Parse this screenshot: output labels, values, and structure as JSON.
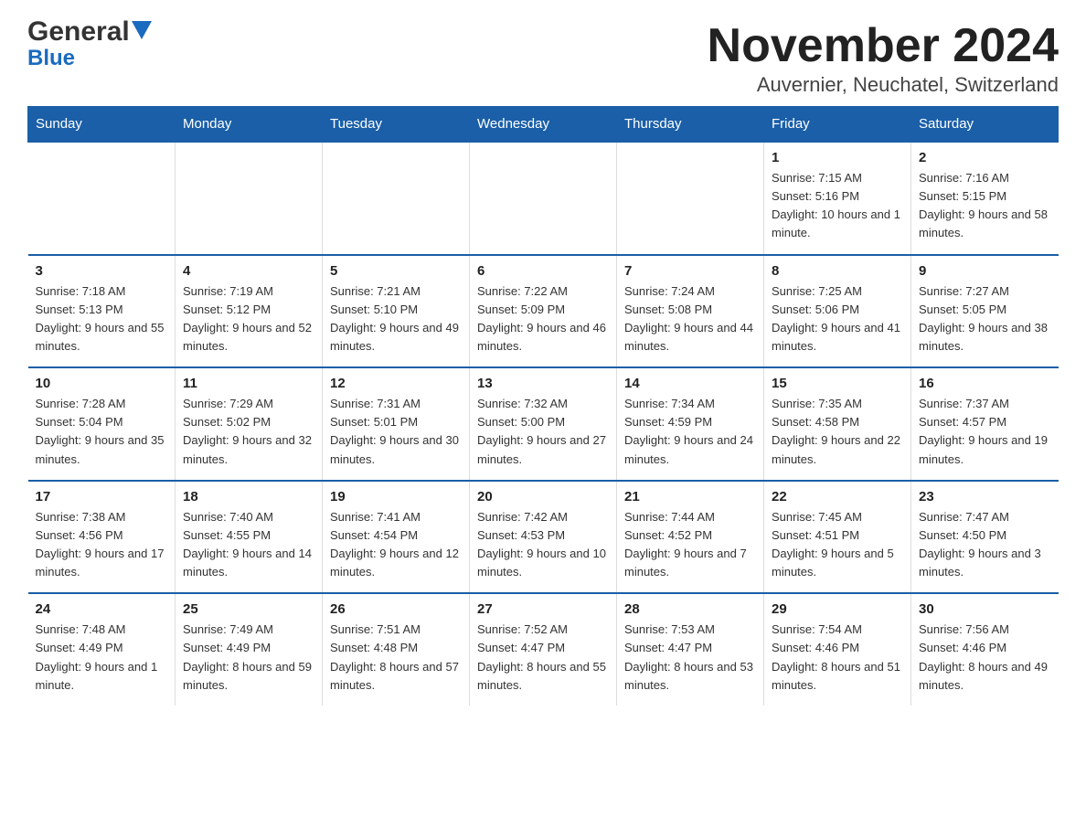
{
  "header": {
    "logo_line1": "General",
    "logo_line2": "Blue",
    "month_title": "November 2024",
    "location": "Auvernier, Neuchatel, Switzerland"
  },
  "weekdays": [
    "Sunday",
    "Monday",
    "Tuesday",
    "Wednesday",
    "Thursday",
    "Friday",
    "Saturday"
  ],
  "weeks": [
    [
      {
        "day": "",
        "info": ""
      },
      {
        "day": "",
        "info": ""
      },
      {
        "day": "",
        "info": ""
      },
      {
        "day": "",
        "info": ""
      },
      {
        "day": "",
        "info": ""
      },
      {
        "day": "1",
        "info": "Sunrise: 7:15 AM\nSunset: 5:16 PM\nDaylight: 10 hours and 1 minute."
      },
      {
        "day": "2",
        "info": "Sunrise: 7:16 AM\nSunset: 5:15 PM\nDaylight: 9 hours and 58 minutes."
      }
    ],
    [
      {
        "day": "3",
        "info": "Sunrise: 7:18 AM\nSunset: 5:13 PM\nDaylight: 9 hours and 55 minutes."
      },
      {
        "day": "4",
        "info": "Sunrise: 7:19 AM\nSunset: 5:12 PM\nDaylight: 9 hours and 52 minutes."
      },
      {
        "day": "5",
        "info": "Sunrise: 7:21 AM\nSunset: 5:10 PM\nDaylight: 9 hours and 49 minutes."
      },
      {
        "day": "6",
        "info": "Sunrise: 7:22 AM\nSunset: 5:09 PM\nDaylight: 9 hours and 46 minutes."
      },
      {
        "day": "7",
        "info": "Sunrise: 7:24 AM\nSunset: 5:08 PM\nDaylight: 9 hours and 44 minutes."
      },
      {
        "day": "8",
        "info": "Sunrise: 7:25 AM\nSunset: 5:06 PM\nDaylight: 9 hours and 41 minutes."
      },
      {
        "day": "9",
        "info": "Sunrise: 7:27 AM\nSunset: 5:05 PM\nDaylight: 9 hours and 38 minutes."
      }
    ],
    [
      {
        "day": "10",
        "info": "Sunrise: 7:28 AM\nSunset: 5:04 PM\nDaylight: 9 hours and 35 minutes."
      },
      {
        "day": "11",
        "info": "Sunrise: 7:29 AM\nSunset: 5:02 PM\nDaylight: 9 hours and 32 minutes."
      },
      {
        "day": "12",
        "info": "Sunrise: 7:31 AM\nSunset: 5:01 PM\nDaylight: 9 hours and 30 minutes."
      },
      {
        "day": "13",
        "info": "Sunrise: 7:32 AM\nSunset: 5:00 PM\nDaylight: 9 hours and 27 minutes."
      },
      {
        "day": "14",
        "info": "Sunrise: 7:34 AM\nSunset: 4:59 PM\nDaylight: 9 hours and 24 minutes."
      },
      {
        "day": "15",
        "info": "Sunrise: 7:35 AM\nSunset: 4:58 PM\nDaylight: 9 hours and 22 minutes."
      },
      {
        "day": "16",
        "info": "Sunrise: 7:37 AM\nSunset: 4:57 PM\nDaylight: 9 hours and 19 minutes."
      }
    ],
    [
      {
        "day": "17",
        "info": "Sunrise: 7:38 AM\nSunset: 4:56 PM\nDaylight: 9 hours and 17 minutes."
      },
      {
        "day": "18",
        "info": "Sunrise: 7:40 AM\nSunset: 4:55 PM\nDaylight: 9 hours and 14 minutes."
      },
      {
        "day": "19",
        "info": "Sunrise: 7:41 AM\nSunset: 4:54 PM\nDaylight: 9 hours and 12 minutes."
      },
      {
        "day": "20",
        "info": "Sunrise: 7:42 AM\nSunset: 4:53 PM\nDaylight: 9 hours and 10 minutes."
      },
      {
        "day": "21",
        "info": "Sunrise: 7:44 AM\nSunset: 4:52 PM\nDaylight: 9 hours and 7 minutes."
      },
      {
        "day": "22",
        "info": "Sunrise: 7:45 AM\nSunset: 4:51 PM\nDaylight: 9 hours and 5 minutes."
      },
      {
        "day": "23",
        "info": "Sunrise: 7:47 AM\nSunset: 4:50 PM\nDaylight: 9 hours and 3 minutes."
      }
    ],
    [
      {
        "day": "24",
        "info": "Sunrise: 7:48 AM\nSunset: 4:49 PM\nDaylight: 9 hours and 1 minute."
      },
      {
        "day": "25",
        "info": "Sunrise: 7:49 AM\nSunset: 4:49 PM\nDaylight: 8 hours and 59 minutes."
      },
      {
        "day": "26",
        "info": "Sunrise: 7:51 AM\nSunset: 4:48 PM\nDaylight: 8 hours and 57 minutes."
      },
      {
        "day": "27",
        "info": "Sunrise: 7:52 AM\nSunset: 4:47 PM\nDaylight: 8 hours and 55 minutes."
      },
      {
        "day": "28",
        "info": "Sunrise: 7:53 AM\nSunset: 4:47 PM\nDaylight: 8 hours and 53 minutes."
      },
      {
        "day": "29",
        "info": "Sunrise: 7:54 AM\nSunset: 4:46 PM\nDaylight: 8 hours and 51 minutes."
      },
      {
        "day": "30",
        "info": "Sunrise: 7:56 AM\nSunset: 4:46 PM\nDaylight: 8 hours and 49 minutes."
      }
    ]
  ]
}
